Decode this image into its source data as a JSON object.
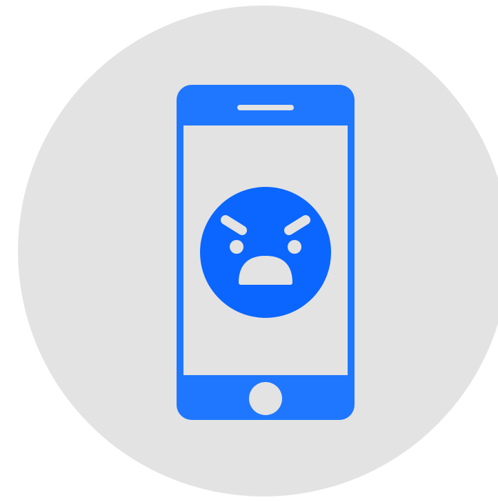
{
  "illustration": {
    "icon": "angry-face-smartphone-icon",
    "colors": {
      "background": "#ffffff",
      "circle": "#e3e3e3",
      "phone": "#1f77ff",
      "screen": "#e3e3e3",
      "emoji_face": "#0a66ff",
      "emoji_features": "#e3e3e3"
    }
  }
}
